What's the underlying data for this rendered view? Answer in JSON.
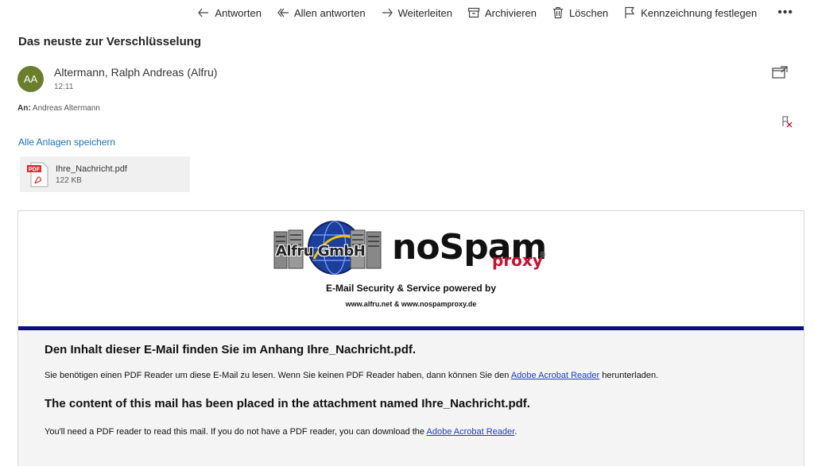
{
  "toolbar": {
    "reply": "Antworten",
    "reply_all": "Allen antworten",
    "forward": "Weiterleiten",
    "archive": "Archivieren",
    "delete": "Löschen",
    "flag": "Kennzeichnung festlegen",
    "more": "•••"
  },
  "message": {
    "subject": "Das neuste zur Verschlüsselung",
    "avatar_initials": "AA",
    "avatar_color": "#6b7e2e",
    "sender": "Altermann, Ralph Andreas (Alfru)",
    "time": "12:11",
    "to_label": "An:",
    "to": "Andreas Altermann"
  },
  "attachments": {
    "save_all": "Alle Anlagen speichern",
    "items": [
      {
        "name": "Ihre_Nachricht.pdf",
        "size": "122 KB",
        "icon": "pdf-file-icon"
      }
    ]
  },
  "body": {
    "logo_alfru": "Alfru GmbH",
    "logo_nospam": "noSpam",
    "logo_proxy": "proxy",
    "logo_reg": "®",
    "powered_by": "E-Mail Security & Service powered by",
    "urls": "www.alfru.net & www.nospamproxy.de",
    "accent_color": "#0d0d84",
    "heading_de": "Den Inhalt dieser E-Mail finden Sie im Anhang Ihre_Nachricht.pdf.",
    "para_de_pre": "Sie benötigen einen PDF Reader um diese E-Mail zu lesen. Wenn Sie keinen PDF Reader haben, dann können Sie den ",
    "para_de_link": "Adobe Acrobat Reader",
    "para_de_post": " herunterladen.",
    "heading_en": "The content of this mail has been placed in the attachment named Ihre_Nachricht.pdf.",
    "para_en_pre": "You'll need a PDF reader to read this mail. If you do not have a PDF reader, you can download the ",
    "para_en_link": "Adobe Acrobat Reader",
    "para_en_post": "."
  }
}
